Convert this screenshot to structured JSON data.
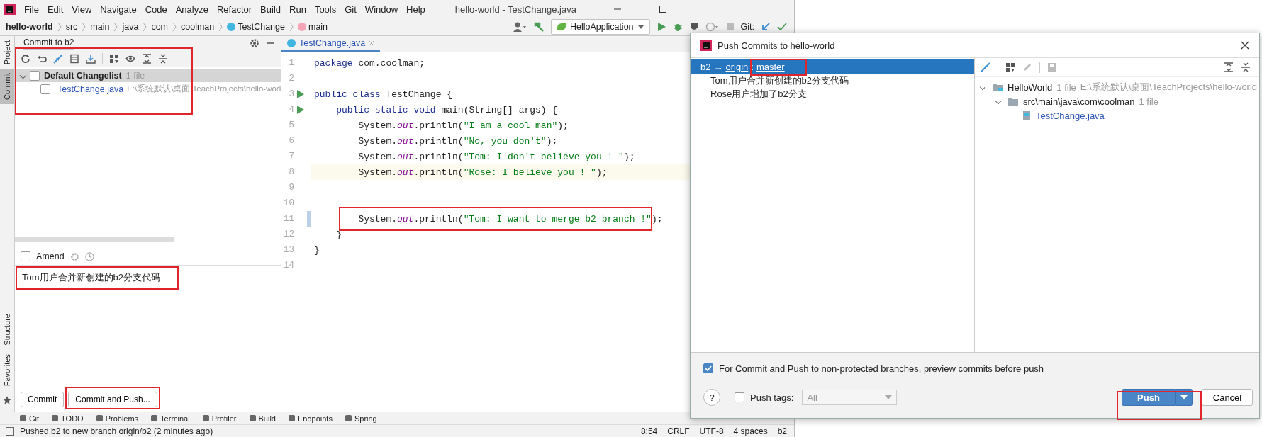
{
  "menu": [
    "File",
    "Edit",
    "View",
    "Navigate",
    "Code",
    "Analyze",
    "Refactor",
    "Build",
    "Run",
    "Tools",
    "Git",
    "Window",
    "Help"
  ],
  "window_title": "hello-world - TestChange.java",
  "breadcrumbs": [
    {
      "label": "hello-world",
      "kind": "project"
    },
    {
      "label": "src",
      "kind": "folder"
    },
    {
      "label": "main",
      "kind": "folder"
    },
    {
      "label": "java",
      "kind": "folder"
    },
    {
      "label": "com",
      "kind": "folder"
    },
    {
      "label": "coolman",
      "kind": "folder"
    },
    {
      "label": "TestChange",
      "kind": "class"
    },
    {
      "label": "main",
      "kind": "method"
    }
  ],
  "run_config": "HelloApplication",
  "git_label": "Git:",
  "side_tabs": [
    {
      "label": "Project",
      "selected": false
    },
    {
      "label": "Commit",
      "selected": true
    }
  ],
  "side_tabs_bottom": [
    "Structure",
    "Favorites"
  ],
  "commit_panel": {
    "title": "Commit to b2",
    "changelist": {
      "name": "Default Changelist",
      "count": "1 file",
      "checked": false,
      "expanded": true
    },
    "files": [
      {
        "name": "TestChange.java",
        "path": "E:\\系统默认\\桌面\\TeachProjects\\hello-worl",
        "checked": false
      }
    ],
    "amend": {
      "label": "Amend",
      "checked": false
    },
    "message": "Tom用户合并新创建的b2分支代码",
    "buttons": [
      "Commit",
      "Commit and Push..."
    ]
  },
  "editor": {
    "tab": "TestChange.java",
    "lines": [
      {
        "number": "1",
        "run": false,
        "current": false,
        "changed": false,
        "tokens": [
          {
            "kind": "keyword",
            "text": "package"
          },
          {
            "kind": "plain",
            "text": " com.coolman;"
          }
        ]
      },
      {
        "number": "2",
        "run": false,
        "current": false,
        "changed": false
      },
      {
        "number": "3",
        "run": true,
        "current": false,
        "changed": false,
        "tokens": [
          {
            "kind": "keyword",
            "text": "public class"
          },
          {
            "kind": "plain",
            "text": " TestChange {"
          }
        ]
      },
      {
        "number": "4",
        "run": true,
        "current": false,
        "changed": false,
        "tokens": [
          {
            "kind": "keyword",
            "text": "    public static void"
          },
          {
            "kind": "plain",
            "text": " main(String[] args) {"
          }
        ]
      },
      {
        "number": "5",
        "run": false,
        "current": false,
        "changed": false,
        "tokens": [
          {
            "kind": "plain",
            "text": "        System."
          },
          {
            "kind": "field",
            "text": "out"
          },
          {
            "kind": "plain",
            "text": ".println("
          },
          {
            "kind": "string",
            "text": "\"I am a cool man\""
          },
          {
            "kind": "plain",
            "text": ");"
          }
        ]
      },
      {
        "number": "6",
        "run": false,
        "current": false,
        "changed": false,
        "tokens": [
          {
            "kind": "plain",
            "text": "        System."
          },
          {
            "kind": "field",
            "text": "out"
          },
          {
            "kind": "plain",
            "text": ".println("
          },
          {
            "kind": "string",
            "text": "\"No, you don't\""
          },
          {
            "kind": "plain",
            "text": ");"
          }
        ]
      },
      {
        "number": "7",
        "run": false,
        "current": false,
        "changed": false,
        "tokens": [
          {
            "kind": "plain",
            "text": "        System."
          },
          {
            "kind": "field",
            "text": "out"
          },
          {
            "kind": "plain",
            "text": ".println("
          },
          {
            "kind": "string",
            "text": "\"Tom: I don't believe you ! \""
          },
          {
            "kind": "plain",
            "text": ");"
          }
        ]
      },
      {
        "number": "8",
        "run": false,
        "current": true,
        "changed": false,
        "tokens": [
          {
            "kind": "plain",
            "text": "        System."
          },
          {
            "kind": "field",
            "text": "out"
          },
          {
            "kind": "plain",
            "text": ".println("
          },
          {
            "kind": "string",
            "text": "\"Rose: I believe you ! \""
          },
          {
            "kind": "plain",
            "text": ");"
          }
        ]
      },
      {
        "number": "9",
        "run": false,
        "current": false,
        "changed": false
      },
      {
        "number": "10",
        "run": false,
        "current": false,
        "changed": false
      },
      {
        "number": "11",
        "run": false,
        "current": false,
        "changed": true,
        "tokens": [
          {
            "kind": "plain",
            "text": "        System."
          },
          {
            "kind": "field",
            "text": "out"
          },
          {
            "kind": "plain",
            "text": ".println("
          },
          {
            "kind": "string",
            "text": "\"Tom: I want to merge b2 branch !\""
          },
          {
            "kind": "plain",
            "text": ");"
          }
        ]
      },
      {
        "number": "12",
        "run": false,
        "current": false,
        "changed": false,
        "tokens": [
          {
            "kind": "plain",
            "text": "    }"
          }
        ]
      },
      {
        "number": "13",
        "run": false,
        "current": false,
        "changed": false,
        "tokens": [
          {
            "kind": "plain",
            "text": "}"
          }
        ]
      },
      {
        "number": "14",
        "run": false,
        "current": false,
        "changed": false
      }
    ]
  },
  "tool_windows": [
    "Git",
    "TODO",
    "Problems",
    "Terminal",
    "Profiler",
    "Build",
    "Endpoints",
    "Spring"
  ],
  "status_bar": {
    "message": "Pushed b2 to new branch origin/b2 (2 minutes ago)",
    "items": [
      "8:54",
      "CRLF",
      "UTF-8",
      "4 spaces",
      "b2"
    ]
  },
  "dialog": {
    "title": "Push Commits to hello-world",
    "branch": {
      "local": "b2",
      "arrow": "→",
      "remote": "origin",
      "separator": ":",
      "target": "master",
      "selected": true
    },
    "commits": [
      "Tom用户合并新创建的b2分支代码",
      "Rose用户增加了b2分支"
    ],
    "tree": [
      {
        "name": "HelloWorld",
        "count": "1 file",
        "path": "E:\\系统默认\\桌面\\TeachProjects\\hello-world",
        "kind": "module",
        "children": [
          {
            "name": "src\\main\\java\\com\\coolman",
            "count": "1 file",
            "kind": "folder",
            "children": [
              {
                "name": "TestChange.java",
                "kind": "file"
              }
            ]
          }
        ]
      }
    ],
    "preview_option": {
      "label": "For Commit and Push to non-protected branches, preview commits before push",
      "checked": true
    },
    "push_tags": {
      "label": "Push tags:",
      "checked": false,
      "value": "All"
    },
    "help": "?",
    "push_button": "Push",
    "cancel_button": "Cancel"
  }
}
